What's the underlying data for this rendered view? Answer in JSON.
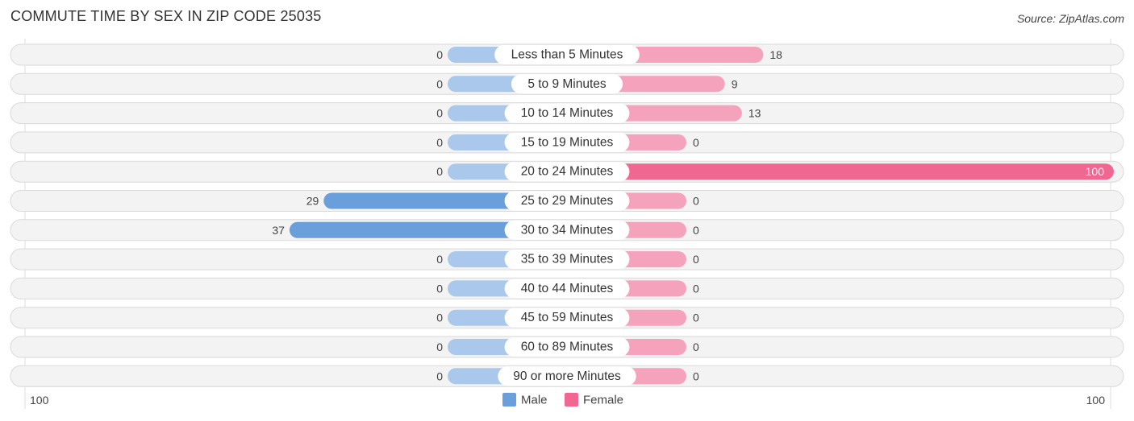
{
  "header": {
    "title": "COMMUTE TIME BY SEX IN ZIP CODE 25035",
    "source": "Source: ZipAtlas.com"
  },
  "chart_data": {
    "type": "bar",
    "orientation": "horizontal-diverging",
    "title": "COMMUTE TIME BY SEX IN ZIP CODE 25035",
    "categories": [
      "Less than 5 Minutes",
      "5 to 9 Minutes",
      "10 to 14 Minutes",
      "15 to 19 Minutes",
      "20 to 24 Minutes",
      "25 to 29 Minutes",
      "30 to 34 Minutes",
      "35 to 39 Minutes",
      "40 to 44 Minutes",
      "45 to 59 Minutes",
      "60 to 89 Minutes",
      "90 or more Minutes"
    ],
    "series": [
      {
        "name": "Male",
        "color": "#6a9fdc",
        "light_color": "#a9c8ec",
        "side": "left",
        "values": [
          0,
          0,
          0,
          0,
          0,
          29,
          37,
          0,
          0,
          0,
          0,
          0
        ]
      },
      {
        "name": "Female",
        "color": "#f06891",
        "light_color": "#f5a3bd",
        "side": "right",
        "values": [
          18,
          9,
          13,
          0,
          100,
          0,
          0,
          0,
          0,
          0,
          0,
          0
        ]
      }
    ],
    "axis": {
      "left_label": "100",
      "right_label": "100",
      "max": 100
    },
    "legend": {
      "position": "bottom-center",
      "items": [
        "Male",
        "Female"
      ]
    },
    "grid": false
  }
}
